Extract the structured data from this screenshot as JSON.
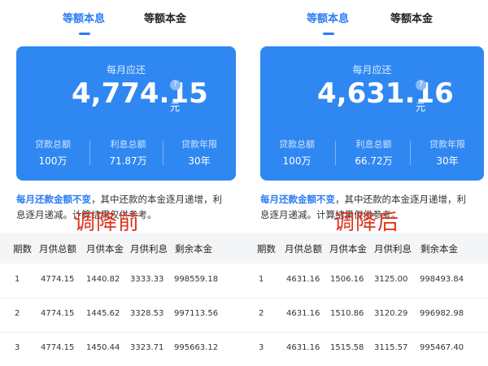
{
  "panels": [
    {
      "tabs": [
        {
          "label": "等额本息",
          "active": true
        },
        {
          "label": "等额本金",
          "active": false
        }
      ],
      "card": {
        "label": "每月应还",
        "amount": "4,774.15",
        "help_glyph": "?",
        "unit": "元",
        "stats": [
          {
            "label": "贷款总额",
            "value": "100万"
          },
          {
            "label": "利息总额",
            "value": "71.87万"
          },
          {
            "label": "贷款年限",
            "value": "30年"
          }
        ]
      },
      "notice": {
        "highlight": "每月还款金额不变",
        "line1_rest": "，其中还款的本金逐月递增，利",
        "line2": "息逐月递减。计算结果仅供参考。"
      },
      "overlay_label": "调降前",
      "table": {
        "headers": [
          "期数",
          "月供总额",
          "月供本金",
          "月供利息",
          "剩余本金"
        ],
        "rows": [
          [
            "1",
            "4774.15",
            "1440.82",
            "3333.33",
            "998559.18"
          ],
          [
            "2",
            "4774.15",
            "1445.62",
            "3328.53",
            "997113.56"
          ],
          [
            "3",
            "4774.15",
            "1450.44",
            "3323.71",
            "995663.12"
          ]
        ]
      }
    },
    {
      "tabs": [
        {
          "label": "等额本息",
          "active": true
        },
        {
          "label": "等额本金",
          "active": false
        }
      ],
      "card": {
        "label": "每月应还",
        "amount": "4,631.16",
        "help_glyph": "?",
        "unit": "元",
        "stats": [
          {
            "label": "贷款总额",
            "value": "100万"
          },
          {
            "label": "利息总额",
            "value": "66.72万"
          },
          {
            "label": "贷款年限",
            "value": "30年"
          }
        ]
      },
      "notice": {
        "highlight": "每月还款金额不变",
        "line1_rest": "，其中还款的本金逐月递增，利",
        "line2": "息逐月递减。计算结果仅供参考。"
      },
      "overlay_label": "调降后",
      "table": {
        "headers": [
          "期数",
          "月供总额",
          "月供本金",
          "月供利息",
          "剩余本金"
        ],
        "rows": [
          [
            "1",
            "4631.16",
            "1506.16",
            "3125.00",
            "998493.84"
          ],
          [
            "2",
            "4631.16",
            "1510.86",
            "3120.29",
            "996982.98"
          ],
          [
            "3",
            "4631.16",
            "1515.58",
            "3115.57",
            "995467.40"
          ]
        ]
      }
    }
  ],
  "colors": {
    "accent": "#2b7cf5",
    "card": "#2f87f2",
    "overlay_red": "#e0341f",
    "table_header_bg": "#f4f5f7"
  }
}
